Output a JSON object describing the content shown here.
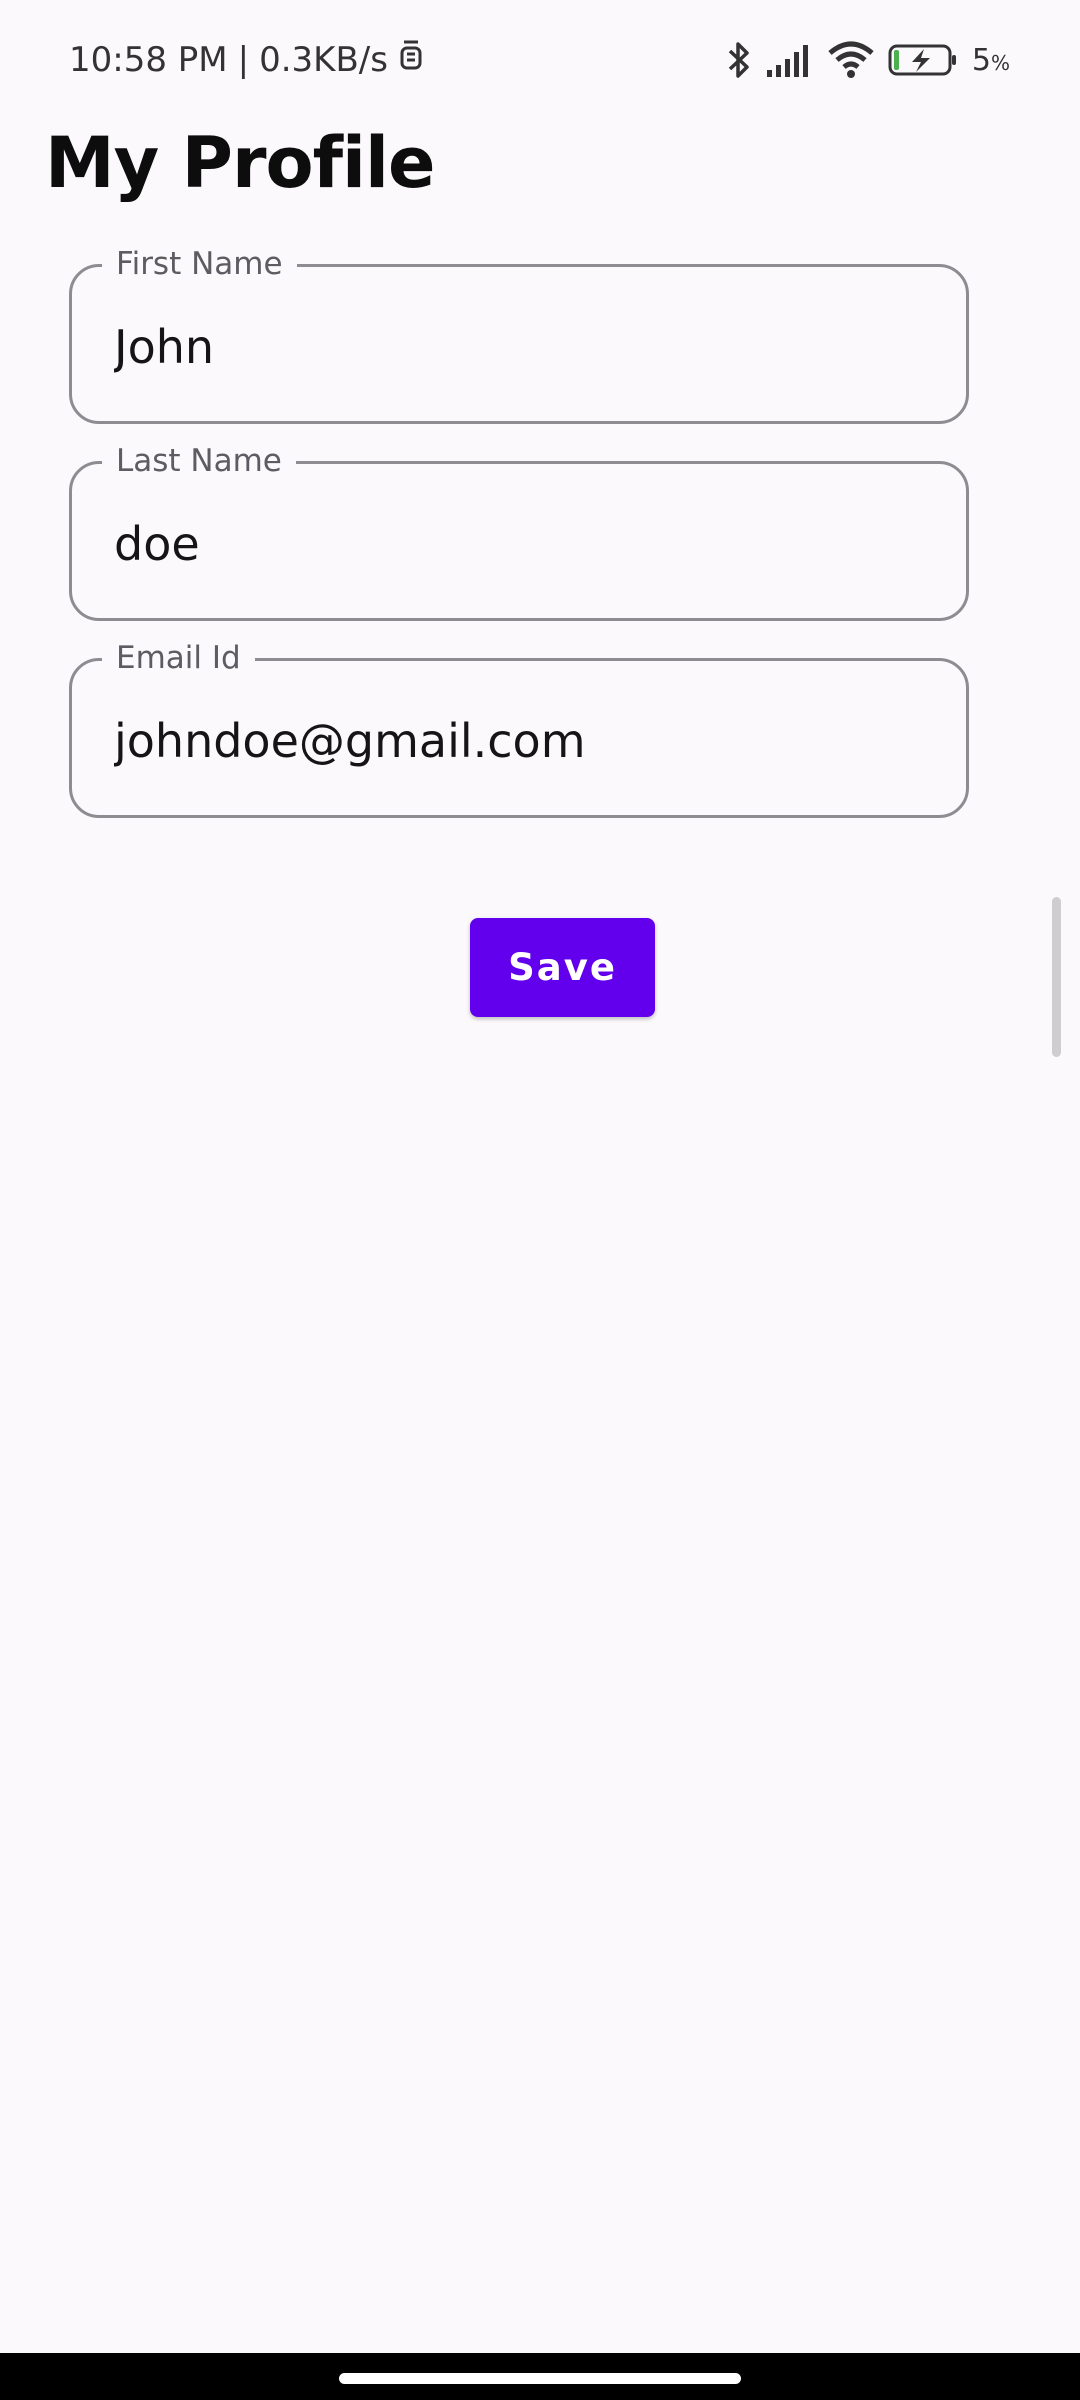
{
  "status_bar": {
    "time": "10:58 PM",
    "separator": "|",
    "network_speed": "0.3KB/s",
    "battery_level": "5",
    "battery_unit": "%",
    "icons": [
      "notification-icon",
      "bluetooth-icon",
      "signal-icon",
      "wifi-icon",
      "battery-charging-icon"
    ]
  },
  "page": {
    "title": "My Profile"
  },
  "form": {
    "first_name": {
      "label": "First Name",
      "value": "John"
    },
    "last_name": {
      "label": "Last Name",
      "value": "doe"
    },
    "email": {
      "label": "Email Id",
      "value": "johndoe@gmail.com"
    },
    "save_label": "Save"
  },
  "colors": {
    "accent": "#6200ee",
    "background": "#fcf9fc",
    "field_border": "#8e8c91"
  }
}
